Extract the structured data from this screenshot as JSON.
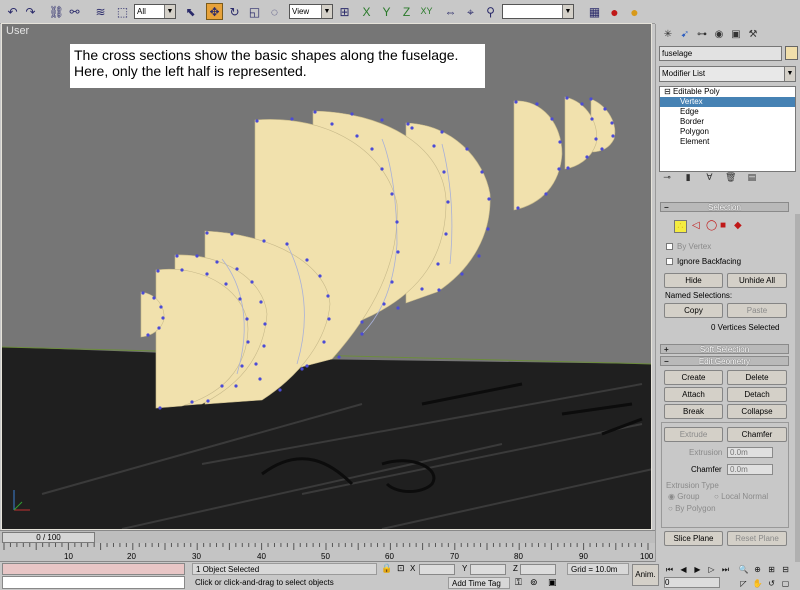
{
  "toolbar": {
    "selection_filter": "All",
    "ref_coord": "View",
    "named_selection": ""
  },
  "viewport": {
    "label": "User",
    "note": "The cross sections show the basic shapes along the fuselage.  Here, only the left half is represented."
  },
  "command_panel": {
    "object_name": "fuselage",
    "modifier_list": "Modifier List",
    "stack": [
      "Editable Poly",
      "Vertex",
      "Edge",
      "Border",
      "Polygon",
      "Element"
    ],
    "selection": {
      "title": "Selection",
      "by_vertex": "By Vertex",
      "ignore_backfacing": "Ignore Backfacing",
      "hide": "Hide",
      "unhide_all": "Unhide All",
      "named_selections": "Named Selections:",
      "copy": "Copy",
      "paste": "Paste",
      "status": "0 Vertices Selected"
    },
    "soft_selection": {
      "title": "Soft Selection"
    },
    "edit_geometry": {
      "title": "Edit Geometry",
      "create": "Create",
      "delete": "Delete",
      "attach": "Attach",
      "detach": "Detach",
      "break": "Break",
      "collapse": "Collapse",
      "extrude": "Extrude",
      "chamfer": "Chamfer",
      "extrusion_label": "Extrusion",
      "extrusion_value": "0.0m",
      "chamfer_label": "Chamfer",
      "chamfer_value": "0.0m",
      "extrusion_type": "Extrusion Type",
      "group": "Group",
      "local_normal": "Local Normal",
      "by_polygon": "By Polygon",
      "slice_plane": "Slice Plane",
      "reset_plane": "Reset Plane"
    }
  },
  "timeline": {
    "slider": "0 / 100",
    "ticks": [
      "10",
      "20",
      "30",
      "40",
      "50",
      "60",
      "70",
      "80",
      "90",
      "100"
    ]
  },
  "status_bar": {
    "selected": "1 Object Selected",
    "prompt": "Click or click-and-drag to select objects",
    "x_label": "X",
    "y_label": "Y",
    "z_label": "Z",
    "grid": "Grid = 10.0m",
    "add_time_tag": "Add Time Tag",
    "anim": "Anim.",
    "frame": "0"
  }
}
